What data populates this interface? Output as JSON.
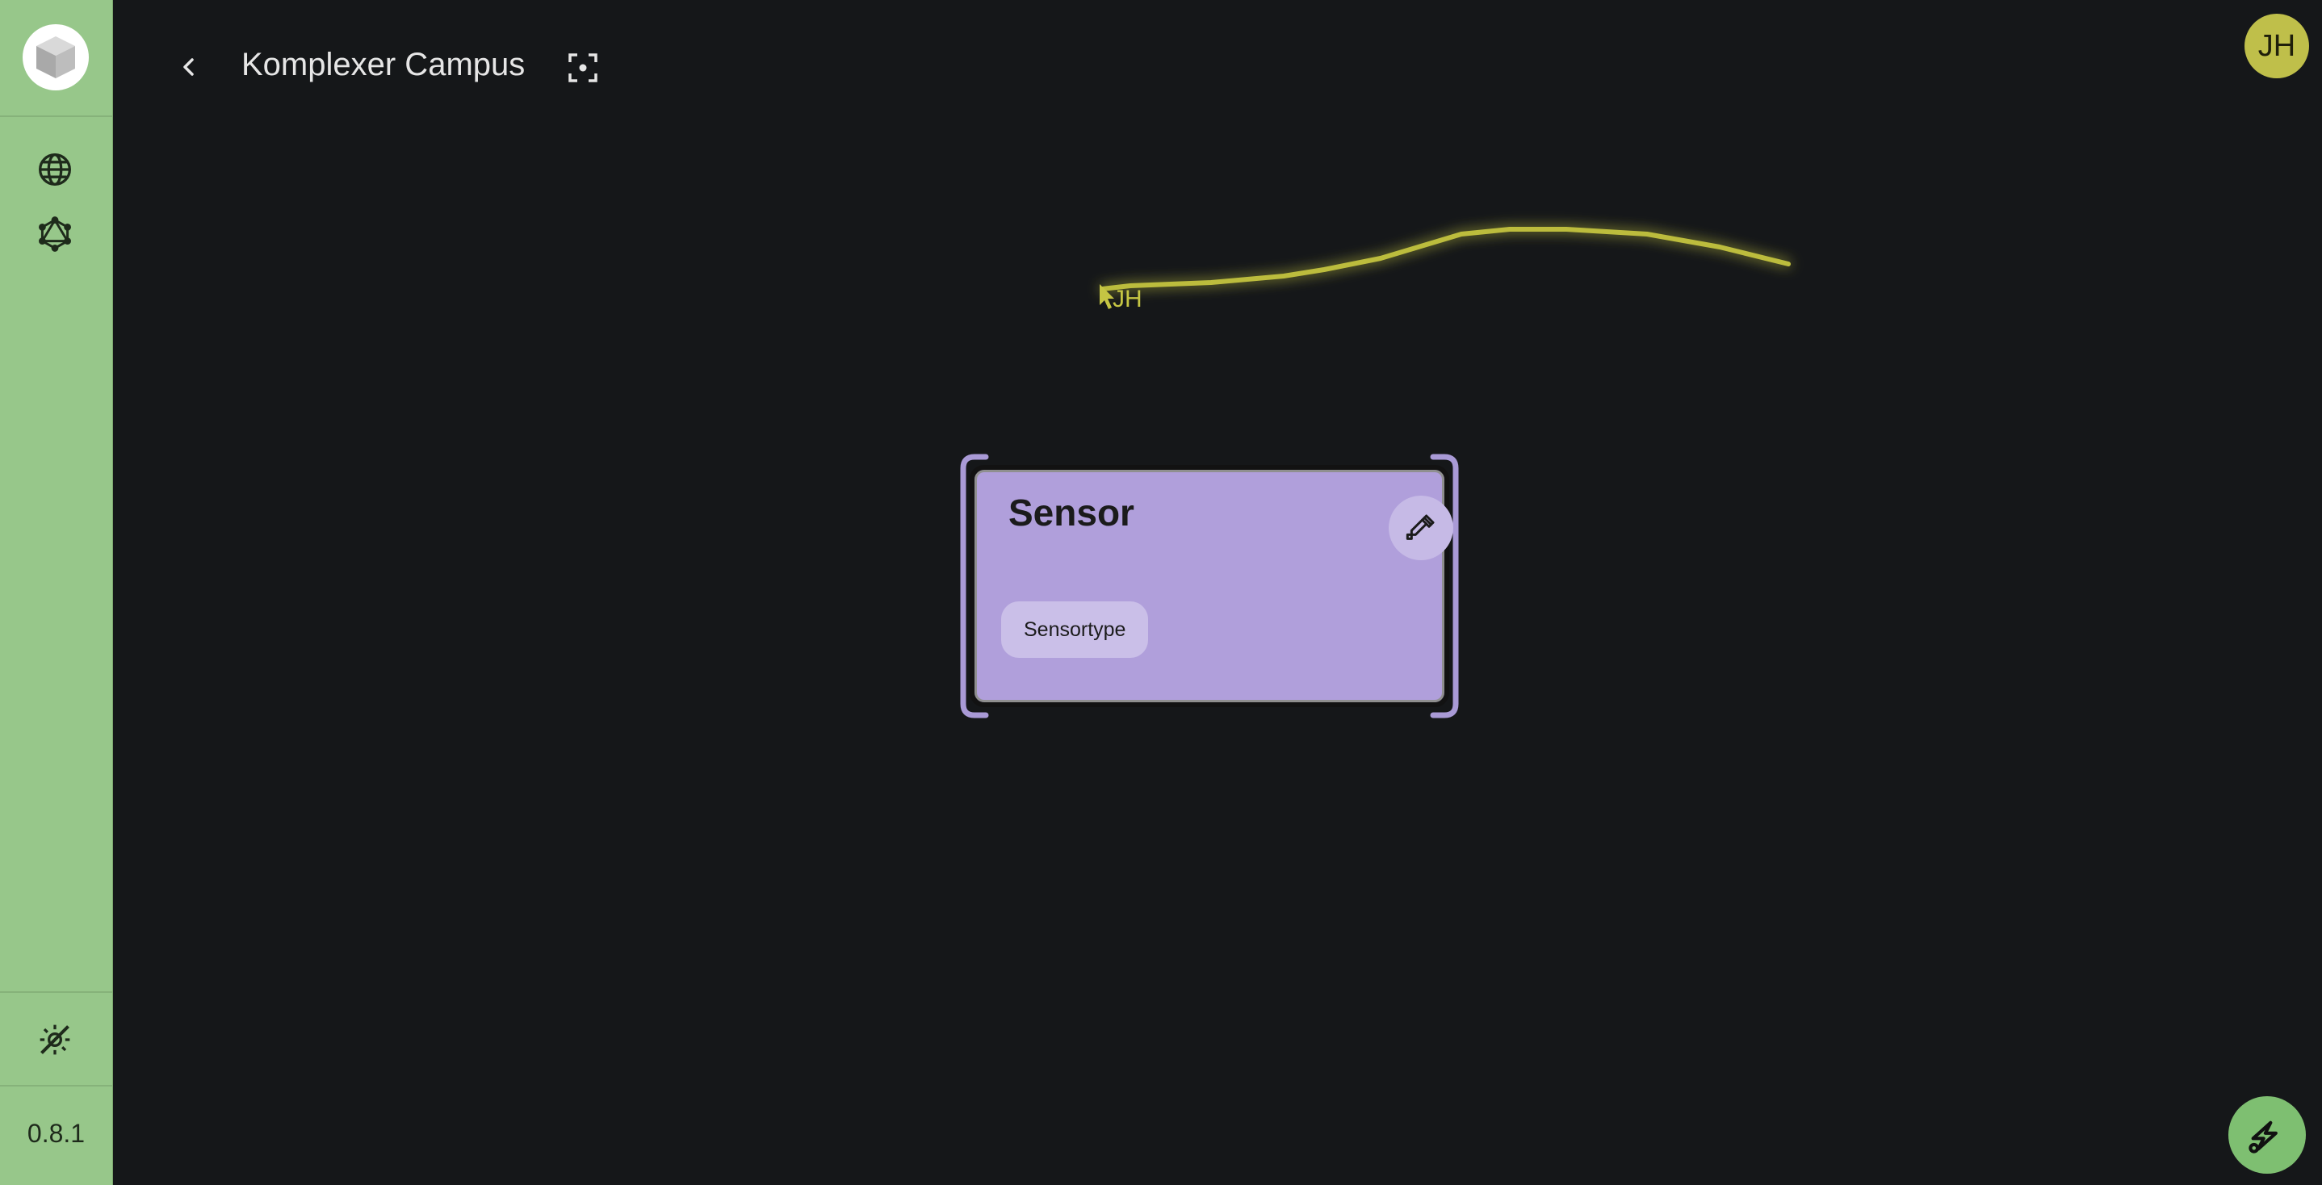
{
  "sidebar": {
    "logo_icon": "cube-icon",
    "nav": [
      {
        "icon": "globe-icon"
      },
      {
        "icon": "graphql-icon"
      }
    ],
    "theme_icon": "theme-toggle-icon",
    "version": "0.8.1"
  },
  "header": {
    "back_icon": "chevron-left-icon",
    "title": "Komplexer Campus",
    "focus_icon": "center-focus-icon"
  },
  "user": {
    "initials": "JH",
    "color": "#bfbf4a"
  },
  "canvas": {
    "cursor": {
      "label": "JH",
      "color": "#c5c543"
    },
    "node": {
      "title": "Sensor",
      "edit_icon": "eyedropper-icon",
      "chip": "Sensortype",
      "color": "#b09fdb"
    }
  },
  "fab": {
    "icon": "lightning-link-icon"
  },
  "colors": {
    "sidebar": "#97c78a",
    "background": "#151719",
    "accent": "#7ebf71"
  }
}
